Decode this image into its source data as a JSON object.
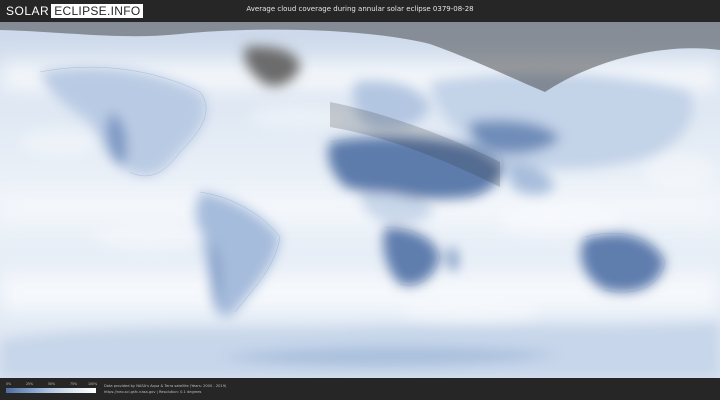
{
  "header": {
    "logo_solar": "SOLAR",
    "logo_eclipse": "ECLIPSE.INFO",
    "title": "Average cloud coverage during annular solar eclipse 0379-08-28"
  },
  "legend": {
    "ticks": [
      "0%",
      "25%",
      "50%",
      "75%",
      "100%"
    ],
    "colors": [
      "#4f6e9e",
      "#7f9cc6",
      "#b5c9e3",
      "#dfe8f3",
      "#ffffff"
    ]
  },
  "footer": {
    "credit_line1": "Data provided by NASA's Aqua & Terra satellite (Years: 2000 - 2019)",
    "credit_line2": "https://neo.sci.gsfc.nasa.gov | Resolution: 0.1 degrees"
  },
  "map": {
    "ocean_color": "#e8eff7",
    "cloudy_color": "#ffffff",
    "clear_color": "#5b79a8",
    "night_shade_color": "#3a3a3a"
  }
}
